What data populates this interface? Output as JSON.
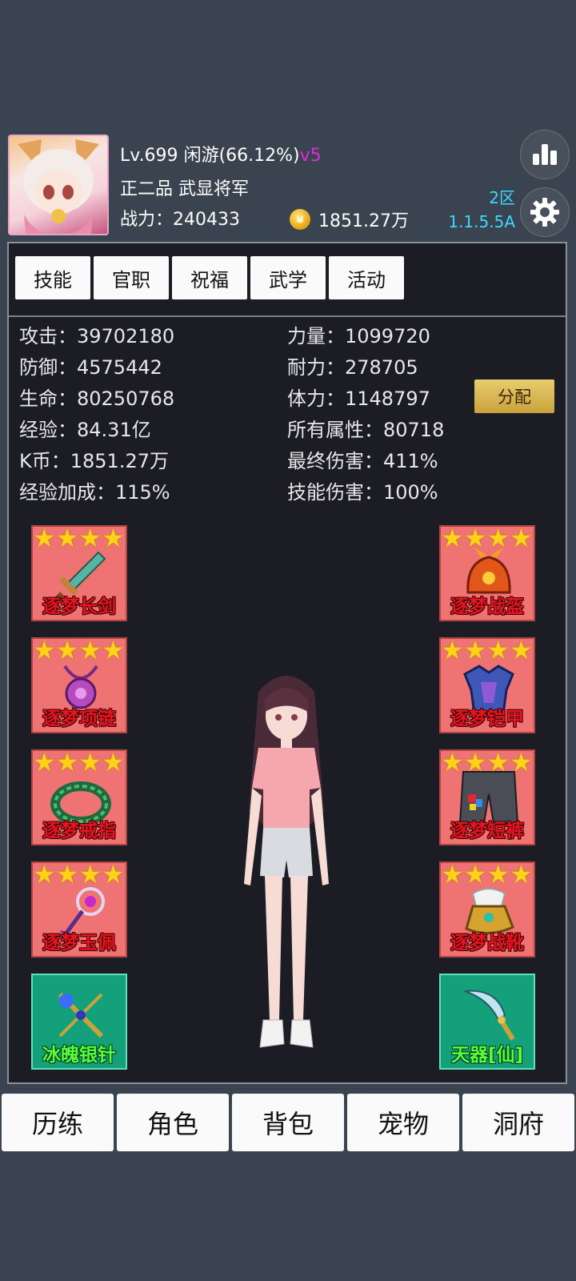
{
  "header": {
    "level": "Lv.699",
    "status": "闲游(66.12%)",
    "vip": "v5",
    "rank": "正二品",
    "title": "武显将军",
    "power_label": "战力：",
    "power_value": "240433",
    "coins": "1851.27万",
    "server_zone": "2区",
    "version": "1.1.5.5A"
  },
  "tabs": [
    "技能",
    "官职",
    "祝福",
    "武学",
    "活动"
  ],
  "stats_left": [
    {
      "label": "攻击：",
      "value": "39702180"
    },
    {
      "label": "防御：",
      "value": "4575442"
    },
    {
      "label": "生命：",
      "value": "80250768"
    },
    {
      "label": "经验：",
      "value": "84.31亿"
    },
    {
      "label": "K币：",
      "value": "1851.27万"
    },
    {
      "label": "经验加成：",
      "value": "115%"
    }
  ],
  "stats_right": [
    {
      "label": "力量：",
      "value": "1099720"
    },
    {
      "label": "耐力：",
      "value": "278705"
    },
    {
      "label": "体力：",
      "value": "1148797"
    },
    {
      "label": "所有属性：",
      "value": "80718"
    },
    {
      "label": "最终伤害：",
      "value": "411%"
    },
    {
      "label": "技能伤害：",
      "value": "100%"
    }
  ],
  "allocate_label": "分配",
  "equipment_left": [
    {
      "name": "逐梦长剑",
      "stars": 4
    },
    {
      "name": "逐梦项链",
      "stars": 4
    },
    {
      "name": "逐梦戒指",
      "stars": 4
    },
    {
      "name": "逐梦玉佩",
      "stars": 4
    },
    {
      "name": "冰魄银针",
      "stars": 0
    }
  ],
  "equipment_right": [
    {
      "name": "逐梦战盔",
      "stars": 4
    },
    {
      "name": "逐梦铠甲",
      "stars": 4
    },
    {
      "name": "逐梦短裤",
      "stars": 4
    },
    {
      "name": "逐梦战靴",
      "stars": 4
    },
    {
      "name": "天器[仙]",
      "stars": 0
    }
  ],
  "bottom_nav": [
    "历练",
    "角色",
    "背包",
    "宠物",
    "洞府"
  ],
  "icons": {
    "coin": "coin-icon",
    "ranking": "bar-chart-icon",
    "settings": "gear-icon"
  },
  "colors": {
    "vip": "#e32ad8",
    "server": "#3fd6ff",
    "equip_bg": "#ef7373",
    "special_bg": "#13a07a",
    "star": "#ffd21a"
  }
}
